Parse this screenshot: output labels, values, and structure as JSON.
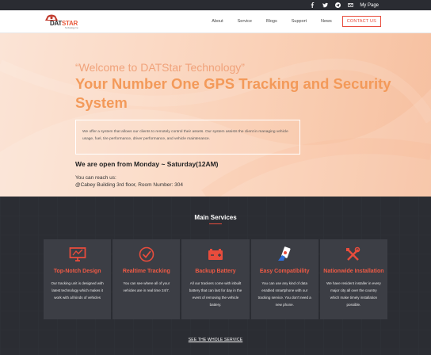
{
  "topbar": {
    "icons": [
      "facebook-icon",
      "twitter-icon",
      "telegram-icon",
      "mail-icon"
    ],
    "my_page": "My Page"
  },
  "nav": {
    "logo": {
      "brand_prefix": "DAT",
      "brand_suffix": "STAR",
      "tagline": "Technology Inc."
    },
    "items": [
      "About",
      "Service",
      "Blogs",
      "Support",
      "News"
    ],
    "contact": "CONTACT US"
  },
  "hero": {
    "welcome": "“Welcome to DATStar Technology”",
    "headline": "Your Number One GPS Tracking and Security System",
    "description": "We offer a system that allows our clients to remotely control their assets. Our system assists the client in managing vehicle usage, fuel, tire performance, driver performance, and vehicle maintenance.",
    "hours": "We are open from Monday ~ Saturday(12AM)",
    "reach_label": "You can reach us:",
    "address": "@Cabey Building 3rd floor, Room Number: 304"
  },
  "services": {
    "title": "Main Services",
    "cards": [
      {
        "title": "Top-Notch Design",
        "icon": "monitor-icon",
        "text": "Our tracking unit is designed with latest technology which makes it work with all kinds of vehicles"
      },
      {
        "title": "Realtime Tracking",
        "icon": "check-circle-icon",
        "text": "You can see where all of your vehicles are in real time 24/7."
      },
      {
        "title": "Backup Battery",
        "icon": "battery-icon",
        "text": "All our trackers come with inbuilt battery that can last for day in the event of removing the vehicle battery."
      },
      {
        "title": "Easy Compatibility",
        "icon": "phone-hand-icon",
        "text": "You can use any kind of data enabled smartphone with our tracking service. You don't need a new phone."
      },
      {
        "title": "Nationwide Installation",
        "icon": "tools-icon",
        "text": "We have resident installer in every major city all over the country which make timely installation possible."
      }
    ],
    "see_all": "SEE THE WHOLE SERVICE"
  },
  "colors": {
    "accent": "#e84c3c",
    "headline": "#f39a5a",
    "dark": "#2b2d33",
    "card": "#3c3e45"
  }
}
